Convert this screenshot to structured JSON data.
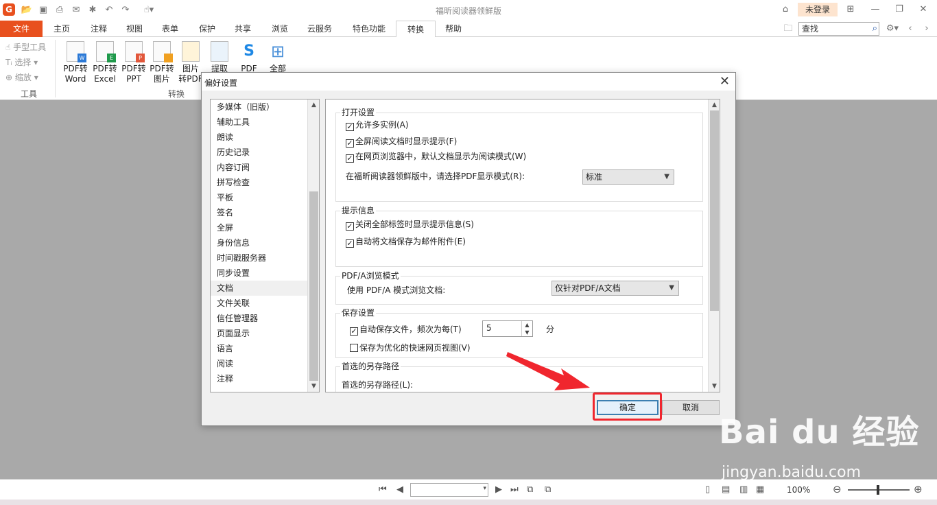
{
  "app": {
    "title": "福昕阅读器领鲜版",
    "logo_letter": "G",
    "login_label": "未登录"
  },
  "tabs": [
    {
      "label": "文件"
    },
    {
      "label": "主页"
    },
    {
      "label": "注释"
    },
    {
      "label": "视图"
    },
    {
      "label": "表单"
    },
    {
      "label": "保护"
    },
    {
      "label": "共享"
    },
    {
      "label": "浏览"
    },
    {
      "label": "云服务"
    },
    {
      "label": "特色功能"
    },
    {
      "label": "转换"
    },
    {
      "label": "帮助"
    }
  ],
  "search": {
    "value": "查找"
  },
  "ribbon": {
    "tools": {
      "hand": "手型工具",
      "select": "选择",
      "zoom": "缩放",
      "group_label": "工具"
    },
    "convert": {
      "group_label": "转换",
      "buttons": [
        {
          "line1": "PDF转",
          "line2": "Word",
          "tag": "W",
          "color": "#2b79d6"
        },
        {
          "line1": "PDF转",
          "line2": "Excel",
          "tag": "E",
          "color": "#1f9a4b"
        },
        {
          "line1": "PDF转",
          "line2": "PPT",
          "tag": "P",
          "color": "#e2573b"
        },
        {
          "line1": "PDF转",
          "line2": "图片",
          "tag": "",
          "color": "#f0a020"
        },
        {
          "line1": "图片",
          "line2": "转PDF",
          "tag": "",
          "color": "#f0a020"
        },
        {
          "line1": "提取",
          "line2": "",
          "tag": "",
          "color": "#5aa0d8"
        },
        {
          "line1": "PDF",
          "line2": "",
          "tag": "S",
          "color": "#1e88e5"
        },
        {
          "line1": "全部",
          "line2": "",
          "tag": "",
          "color": "#4a90d9"
        }
      ]
    }
  },
  "dialog": {
    "title": "偏好设置",
    "categories": [
      "多媒体（旧版）",
      "辅助工具",
      "朗读",
      "历史记录",
      "内容订阅",
      "拼写检查",
      "平板",
      "签名",
      "全屏",
      "身份信息",
      "时间戳服务器",
      "同步设置",
      "文档",
      "文件关联",
      "信任管理器",
      "页面显示",
      "语言",
      "阅读",
      "注释"
    ],
    "selected_category": "文档",
    "sections": {
      "open": {
        "legend": "打开设置",
        "allow_multi": "允许多实例(A)",
        "fullscreen_tip": "全屏阅读文档时显示提示(F)",
        "browser_read_mode": "在网页浏览器中，默认文档显示为阅读模式(W)",
        "display_mode_label": "在福昕阅读器领鲜版中，请选择PDF显示模式(R):",
        "display_mode_value": "标准"
      },
      "tips": {
        "legend": "提示信息",
        "close_all_tabs_tip": "关闭全部标签时显示提示信息(S)",
        "save_as_attachment": "自动将文档保存为邮件附件(E)"
      },
      "pdfa": {
        "legend": "PDF/A浏览模式",
        "label": "使用 PDF/A 模式浏览文档:",
        "value": "仅针对PDF/A文档"
      },
      "save": {
        "legend": "保存设置",
        "autosave_label": "自动保存文件，频次为每(T)",
        "autosave_value": "5",
        "autosave_unit": "分",
        "fast_web_view": "保存为优化的快速网页视图(V)"
      },
      "saveas": {
        "legend": "首选的另存路径",
        "label": "首选的另存路径(L):"
      }
    },
    "ok_label": "确定",
    "cancel_label": "取消"
  },
  "status": {
    "zoom": "100%"
  },
  "watermark": {
    "main": "Bai du 经验",
    "sub": "jingyan.baidu.com"
  },
  "colors": {
    "accent": "#e8501e",
    "highlight": "#f0262e"
  }
}
